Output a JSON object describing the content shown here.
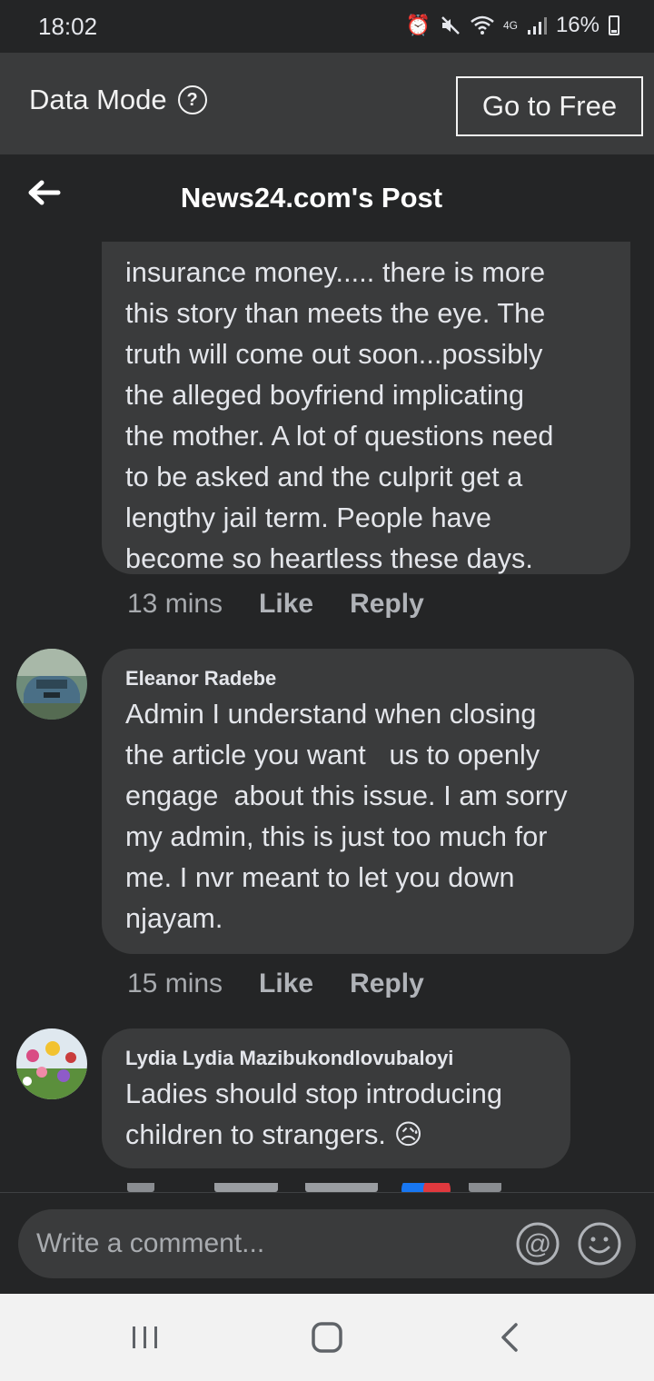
{
  "status_bar": {
    "time": "18:02",
    "battery": "16%",
    "network": "4G"
  },
  "data_mode": {
    "label": "Data Mode",
    "button": "Go to Free"
  },
  "header": {
    "title": "News24.com's Post"
  },
  "comments": [
    {
      "author": "",
      "text": "insurance money..... there is more\nthis story than meets the eye. The\ntruth will come out soon...possibly\nthe alleged boyfriend implicating\nthe mother. A lot of questions need\nto be asked and the culprit get a\nlengthy jail term. People have\nbecome so heartless these days.",
      "time": "13 mins",
      "like": "Like",
      "reply": "Reply"
    },
    {
      "author": "Eleanor Radebe",
      "text": "Admin I understand when closing\nthe article you want   us to openly\nengage  about this issue. I am sorry\nmy admin, this is just too much for\nme. I nvr meant to let you down\nnjayam.",
      "time": "15 mins",
      "like": "Like",
      "reply": "Reply"
    },
    {
      "author": "Lydia Lydia Mazibukondlovubaloyi",
      "text": "Ladies should stop introducing\nchildren to strangers. 😥",
      "time": "",
      "like": "",
      "reply": ""
    }
  ],
  "compose": {
    "placeholder": "Write a comment..."
  },
  "colors": {
    "background": "#242526",
    "bubble": "#3a3b3c",
    "text": "#e4e6eb",
    "meta": "#a8abaf"
  }
}
